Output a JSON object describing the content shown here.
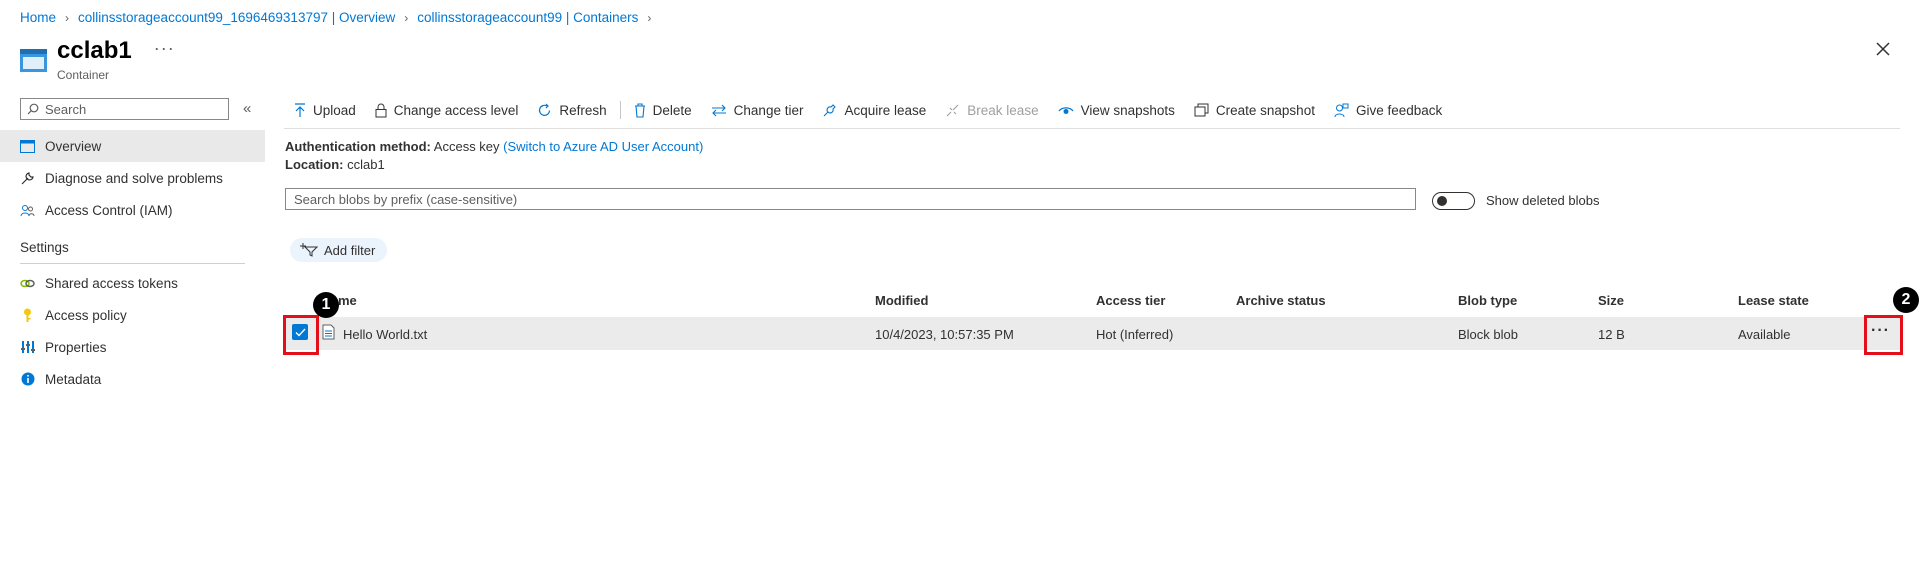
{
  "breadcrumb": {
    "home": "Home",
    "overview": "collinsstorageaccount99_1696469313797 | Overview",
    "containers": "collinsstorageaccount99 | Containers"
  },
  "header": {
    "title": "cclab1",
    "subtitle": "Container",
    "more": "···"
  },
  "sidebar": {
    "search_placeholder": "Search",
    "collapse": "«",
    "items": [
      {
        "label": "Overview",
        "icon": "overview-icon"
      },
      {
        "label": "Diagnose and solve problems",
        "icon": "wrench-icon"
      },
      {
        "label": "Access Control (IAM)",
        "icon": "people-icon"
      }
    ],
    "settings_heading": "Settings",
    "settings_items": [
      {
        "label": "Shared access tokens",
        "icon": "link-icon"
      },
      {
        "label": "Access policy",
        "icon": "key-icon"
      },
      {
        "label": "Properties",
        "icon": "properties-icon"
      },
      {
        "label": "Metadata",
        "icon": "info-icon"
      }
    ]
  },
  "toolbar": {
    "upload": "Upload",
    "change_access": "Change access level",
    "refresh": "Refresh",
    "delete": "Delete",
    "change_tier": "Change tier",
    "acquire_lease": "Acquire lease",
    "break_lease": "Break lease",
    "view_snapshots": "View snapshots",
    "create_snapshot": "Create snapshot",
    "give_feedback": "Give feedback"
  },
  "info": {
    "auth_label": "Authentication method:",
    "auth_value": "Access key",
    "auth_link": "(Switch to Azure AD User Account)",
    "location_label": "Location:",
    "location_value": "cclab1"
  },
  "blob_search": {
    "placeholder": "Search blobs by prefix (case-sensitive)",
    "toggle_label": "Show deleted blobs"
  },
  "filter": {
    "label": "Add filter"
  },
  "table": {
    "headers": [
      "me",
      "Modified",
      "Access tier",
      "Archive status",
      "Blob type",
      "Size",
      "Lease state"
    ],
    "rows": [
      {
        "name": "Hello World.txt",
        "modified": "10/4/2023, 10:57:35 PM",
        "access_tier": "Hot (Inferred)",
        "archive_status": "",
        "blob_type": "Block blob",
        "size": "12 B",
        "lease_state": "Available",
        "selected": true
      }
    ]
  },
  "annotations": {
    "badge1": "1",
    "badge2": "2",
    "highlight_color": "#e3101b"
  },
  "colors": {
    "accent": "#0078d4",
    "row_selected": "#ebebeb"
  }
}
